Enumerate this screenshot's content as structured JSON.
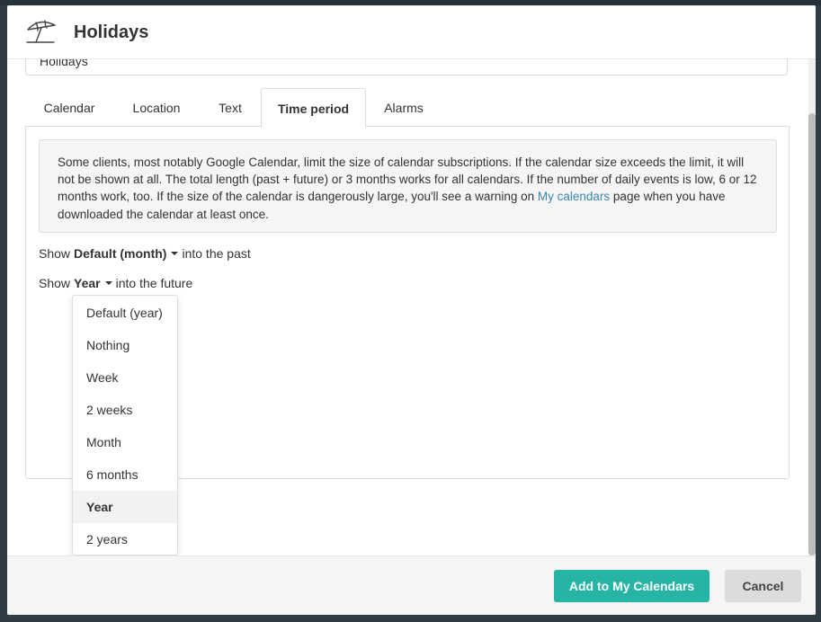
{
  "dialog": {
    "title": "Holidays",
    "icon": "beach-umbrella-icon"
  },
  "name_field": {
    "value": "Holidays"
  },
  "tabs": [
    {
      "label": "Calendar"
    },
    {
      "label": "Location"
    },
    {
      "label": "Text"
    },
    {
      "label": "Time period",
      "active": true
    },
    {
      "label": "Alarms"
    }
  ],
  "info": {
    "text_before_link": "Some clients, most notably Google Calendar, limit the size of calendar subscriptions. If the calendar size exceeds the limit, it will not be shown at all. The total length (past + future) or 3 months works for all calendars. If the number of daily events is low, 6 or 12 months work, too. If the size of the calendar is dangerously large, you'll see a warning on ",
    "link_text": "My calendars",
    "text_after_link": " page when you have downloaded the calendar at least once.",
    "link_color": "#3a87ad"
  },
  "past": {
    "prefix": "Show",
    "value": "Default (month)",
    "suffix": "into the past"
  },
  "future": {
    "prefix": "Show",
    "value": "Year",
    "suffix": "into the future"
  },
  "future_options": [
    {
      "label": "Default (year)"
    },
    {
      "label": "Nothing"
    },
    {
      "label": "Week"
    },
    {
      "label": "2 weeks"
    },
    {
      "label": "Month"
    },
    {
      "label": "6 months"
    },
    {
      "label": "Year",
      "selected": true
    },
    {
      "label": "2 years"
    }
  ],
  "footer": {
    "add_label": "Add to My Calendars",
    "cancel_label": "Cancel"
  },
  "colors": {
    "primary": "#26b5a5",
    "secondary_button": "#dcdcdc",
    "backdrop": "#2f3c44"
  }
}
